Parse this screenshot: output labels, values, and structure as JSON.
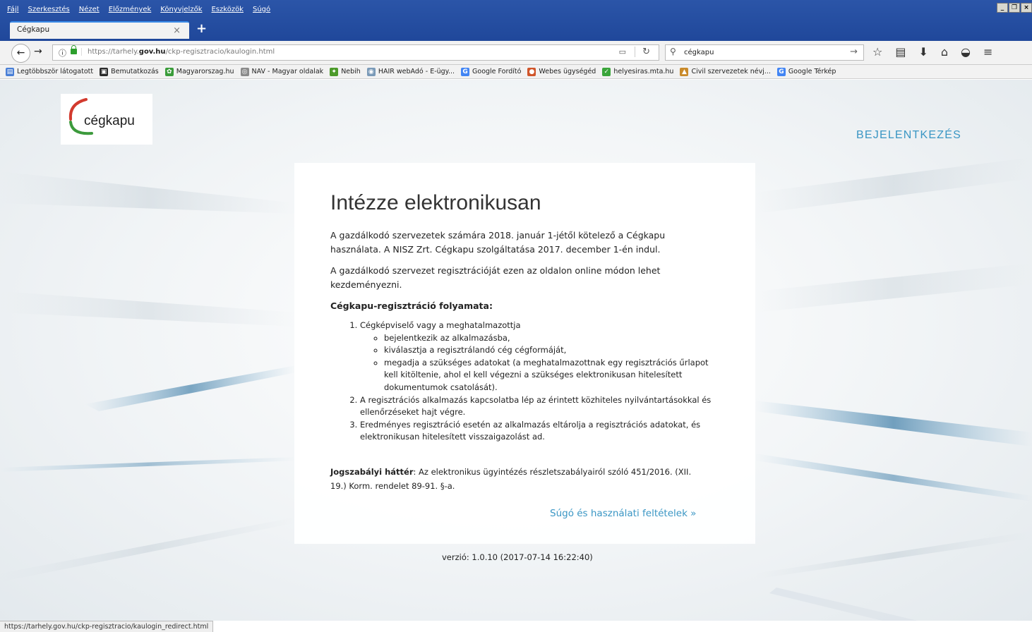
{
  "browser": {
    "menu": [
      "Fájl",
      "Szerkesztés",
      "Nézet",
      "Előzmények",
      "Könyvjelzők",
      "Eszközök",
      "Súgó"
    ],
    "window_controls": [
      "_",
      "❐",
      "×"
    ],
    "tab": {
      "title": "Cégkapu",
      "close": "×"
    },
    "new_tab": "+",
    "url": {
      "prefix": "https://tarhely.",
      "domain": "gov.hu",
      "suffix": "/ckp-regisztracio/kaulogin.html"
    },
    "search": {
      "value": "cégkapu"
    },
    "bookmarks": [
      {
        "label": "Legtöbbször látogatott",
        "color": "#4a7fd6",
        "glyph": "▤"
      },
      {
        "label": "Bemutatkozás",
        "color": "#2a2a2a",
        "glyph": "▣"
      },
      {
        "label": "Magyarorszag.hu",
        "color": "#3a9c3a",
        "glyph": "✿"
      },
      {
        "label": "NAV - Magyar oldalak",
        "color": "#8a8a8a",
        "glyph": "◎"
      },
      {
        "label": "Nebih",
        "color": "#4c9a2a",
        "glyph": "✦"
      },
      {
        "label": "HAIR webAdó - E-ügy...",
        "color": "#7a9ab8",
        "glyph": "◉"
      },
      {
        "label": "Google Fordító",
        "color": "#4285f4",
        "glyph": "G"
      },
      {
        "label": "Webes ügységéd",
        "color": "#d0552a",
        "glyph": "●"
      },
      {
        "label": "helyesiras.mta.hu",
        "color": "#3aa53a",
        "glyph": "✓"
      },
      {
        "label": "Civil szervezetek névj...",
        "color": "#c98a2a",
        "glyph": "▲"
      },
      {
        "label": "Google Térkép",
        "color": "#4285f4",
        "glyph": "G"
      }
    ],
    "status_url": "https://tarhely.gov.hu/ckp-regisztracio/kaulogin_redirect.html"
  },
  "header": {
    "logo_text": "cégkapu",
    "login_label": "BEJELENTKEZÉS"
  },
  "main": {
    "title": "Intézze elektronikusan",
    "paragraph1": "A gazdálkodó szervezetek számára 2018. január 1-jétől kötelező a Cégkapu használata. A NISZ Zrt. Cégkapu szolgáltatása 2017. december 1-én indul.",
    "paragraph2": "A gazdálkodó szervezet regisztrációját ezen az oldalon online módon lehet kezdeményezni.",
    "process_heading": "Cégkapu-regisztráció folyamata:",
    "steps": {
      "step1": "Cégképviselő vagy a meghatalmazottja",
      "step1_sub": [
        "bejelentkezik az alkalmazásba,",
        "kiválasztja a regisztrálandó cég cégformáját,",
        "megadja a szükséges adatokat (a meghatalmazottnak egy regisztrációs űrlapot kell kitöltenie, ahol el kell végezni a szükséges elektronikusan hitelesített dokumentumok csatolását)."
      ],
      "step2": "A regisztrációs alkalmazás kapcsolatba lép az érintett közhiteles nyilvántartásokkal és ellenőrzéseket hajt végre.",
      "step3": "Eredményes regisztráció esetén az alkalmazás eltárolja a regisztrációs adatokat, és elektronikusan hitelesített visszaigazolást ad."
    },
    "legal_label": "Jogszabályi háttér",
    "legal_text": ": Az elektronikus ügyintézés részletszabályairól szóló 451/2016. (XII. 19.) Korm. rendelet 89-91. §-a.",
    "help_link": "Súgó és használati feltételek »"
  },
  "footer": {
    "version": "verzió: 1.0.10 (2017-07-14 16:22:40)"
  },
  "colors": {
    "accent": "#3a96c4",
    "titlebar": "#2b55a8",
    "logo_red": "#d23a2e",
    "logo_green": "#3c9a3c"
  }
}
